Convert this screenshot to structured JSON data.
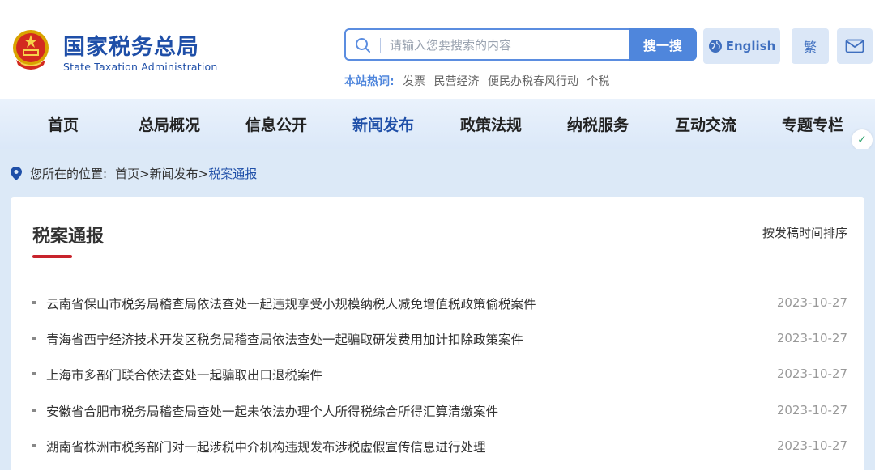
{
  "header": {
    "logo_cn": "国家税务总局",
    "logo_en": "State Taxation Administration",
    "search": {
      "placeholder": "请输入您要搜索的内容",
      "button_label": "搜一搜"
    },
    "hot": {
      "label": "本站热词:",
      "items": [
        "发票",
        "民营经济",
        "便民办税春风行动",
        "个税"
      ]
    },
    "english_label": "English",
    "traditional_label": "繁",
    "icons": {
      "emblem": "national-emblem-icon",
      "search": "search-icon",
      "globe": "globe-icon",
      "mail": "mail-icon"
    }
  },
  "nav": {
    "items": [
      {
        "label": "首页"
      },
      {
        "label": "总局概况"
      },
      {
        "label": "信息公开"
      },
      {
        "label": "新闻发布"
      },
      {
        "label": "政策法规"
      },
      {
        "label": "纳税服务"
      },
      {
        "label": "互动交流"
      },
      {
        "label": "专题专栏"
      }
    ],
    "active_index": 3
  },
  "breadcrumb": {
    "label": "您所在的位置:",
    "home": "首页",
    "sep": ">",
    "section": "新闻发布",
    "current": "税案通报"
  },
  "panel": {
    "title": "税案通报",
    "sort_label": "按发稿时间排序",
    "news": [
      {
        "title": "云南省保山市税务局稽查局依法查处一起违规享受小规模纳税人减免增值税政策偷税案件",
        "date": "2023-10-27"
      },
      {
        "title": "青海省西宁经济技术开发区税务局稽查局依法查处一起骗取研发费用加计扣除政策案件",
        "date": "2023-10-27"
      },
      {
        "title": "上海市多部门联合依法查处一起骗取出口退税案件",
        "date": "2023-10-27"
      },
      {
        "title": "安徽省合肥市税务局稽查局查处一起未依法办理个人所得税综合所得汇算清缴案件",
        "date": "2023-10-27"
      },
      {
        "title": "湖南省株洲市税务部门对一起涉税中介机构违规发布涉税虚假宣传信息进行处理",
        "date": "2023-10-27"
      }
    ]
  },
  "colors": {
    "brand_blue": "#1f4fa8",
    "accent_blue": "#4f86dc",
    "underline_red": "#c8232c",
    "page_bg": "#dce9f7"
  }
}
